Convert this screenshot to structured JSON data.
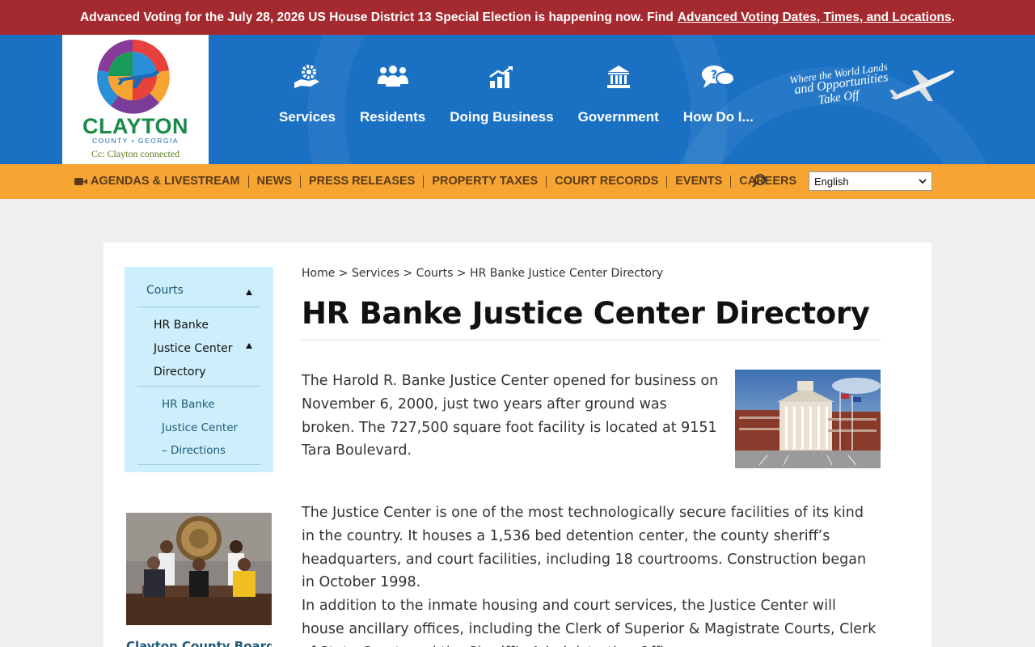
{
  "alert": {
    "text": "Advanced Voting for the July 28, 2026 US House District 13 Special Election is happening now. Find",
    "link": "Advanced Voting Dates, Times, and Locations",
    "end": "."
  },
  "logo": {
    "wordmark": "CLAYTON",
    "county": "COUNTY • GEORGIA",
    "tagline": "Cc: Clayton connected"
  },
  "main_nav": [
    {
      "label": "Services",
      "icon": "services-gear-hand-icon"
    },
    {
      "label": "Residents",
      "icon": "people-group-icon"
    },
    {
      "label": "Doing Business",
      "icon": "bar-chart-icon"
    },
    {
      "label": "Government",
      "icon": "capitol-building-icon"
    },
    {
      "label": "How Do I...",
      "icon": "question-chat-icon"
    }
  ],
  "header_tagline": {
    "line1": "Where the World Lands",
    "line2": "and Opportunities",
    "line3": "Take Off"
  },
  "sub_nav": [
    "AGENDAS & LIVESTREAM",
    "NEWS",
    "PRESS RELEASES",
    "PROPERTY TAXES",
    "COURT RECORDS",
    "EVENTS",
    "CAREERS"
  ],
  "language": {
    "selected": "English"
  },
  "sidebar": {
    "parent": "Courts",
    "current": "HR Banke Justice Center Directory",
    "current_lines": [
      "HR Banke",
      "Justice Center",
      "Directory"
    ],
    "child_lines": [
      "HR Banke",
      "Justice Center",
      "– Directions"
    ]
  },
  "board_caption": "Clayton County Board",
  "breadcrumb": {
    "home": "Home",
    "services": "Services",
    "courts": "Courts",
    "current": "HR Banke Justice Center Directory",
    "sep": ">"
  },
  "page_title": "HR Banke Justice Center Directory",
  "paragraphs": {
    "p1": "The Harold R. Banke Justice Center opened for business on November 6, 2000, just two years after ground was broken. The 727,500 square foot facility is located at 9151 Tara Boulevard.",
    "p2": "The Justice Center is one of the most technologically secure facilities of its kind in the country. It houses a 1,536 bed detention center, the county sheriff’s headquarters, and court facilities, including 18 courtrooms. Construction began in October 1998.",
    "p3": "In addition to the inmate housing and court services, the Justice Center will house ancillary offices, including the Clerk of Superior & Magistrate Courts, Clerk of State Court, and the Sheriff’s Administration Offices."
  },
  "colors": {
    "alert_bg": "#a52a30",
    "header_blue": "#1a71c4",
    "subnav_orange": "#f6a533",
    "sidebar_bg": "#cdeffb",
    "link_blue": "#1f5878"
  }
}
